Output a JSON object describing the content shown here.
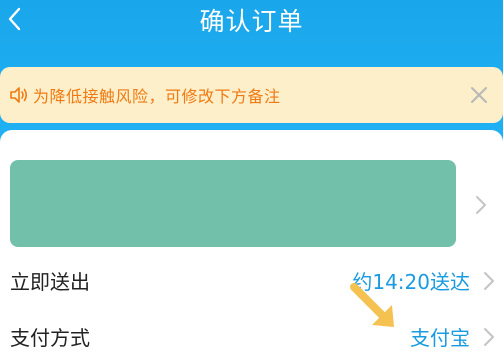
{
  "header": {
    "title": "确认订单"
  },
  "notice": {
    "text": "为降低接触风险，可修改下方备注"
  },
  "delivery": {
    "label": "立即送出",
    "value": "约14:20送达"
  },
  "payment": {
    "label": "支付方式",
    "value": "支付宝"
  },
  "colors": {
    "header_bg": "#1fb0f3",
    "notice_bg": "#fcefc9",
    "notice_text": "#f07a12",
    "accent_blue": "#1a9be0",
    "redaction": "#72c0a9",
    "annotation_arrow": "#f5c251"
  },
  "icons": {
    "back": "chevron-left-icon",
    "speaker": "speaker-icon",
    "close": "close-icon",
    "chevron": "chevron-right-icon"
  }
}
